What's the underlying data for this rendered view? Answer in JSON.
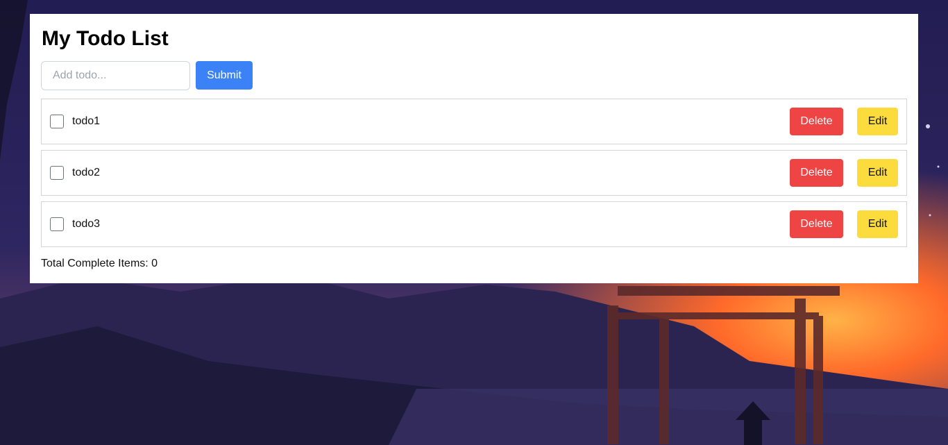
{
  "page": {
    "title": "My Todo List"
  },
  "form": {
    "placeholder": "Add todo...",
    "submit_label": "Submit"
  },
  "todos": [
    {
      "text": "todo1",
      "completed": false,
      "delete_label": "Delete",
      "edit_label": "Edit"
    },
    {
      "text": "todo2",
      "completed": false,
      "delete_label": "Delete",
      "edit_label": "Edit"
    },
    {
      "text": "todo3",
      "completed": false,
      "delete_label": "Delete",
      "edit_label": "Edit"
    }
  ],
  "footer": {
    "total_complete_text": "Total Complete Items: 0"
  },
  "colors": {
    "submit": "#3b82f6",
    "delete": "#ef4444",
    "edit": "#fcdc3c"
  }
}
